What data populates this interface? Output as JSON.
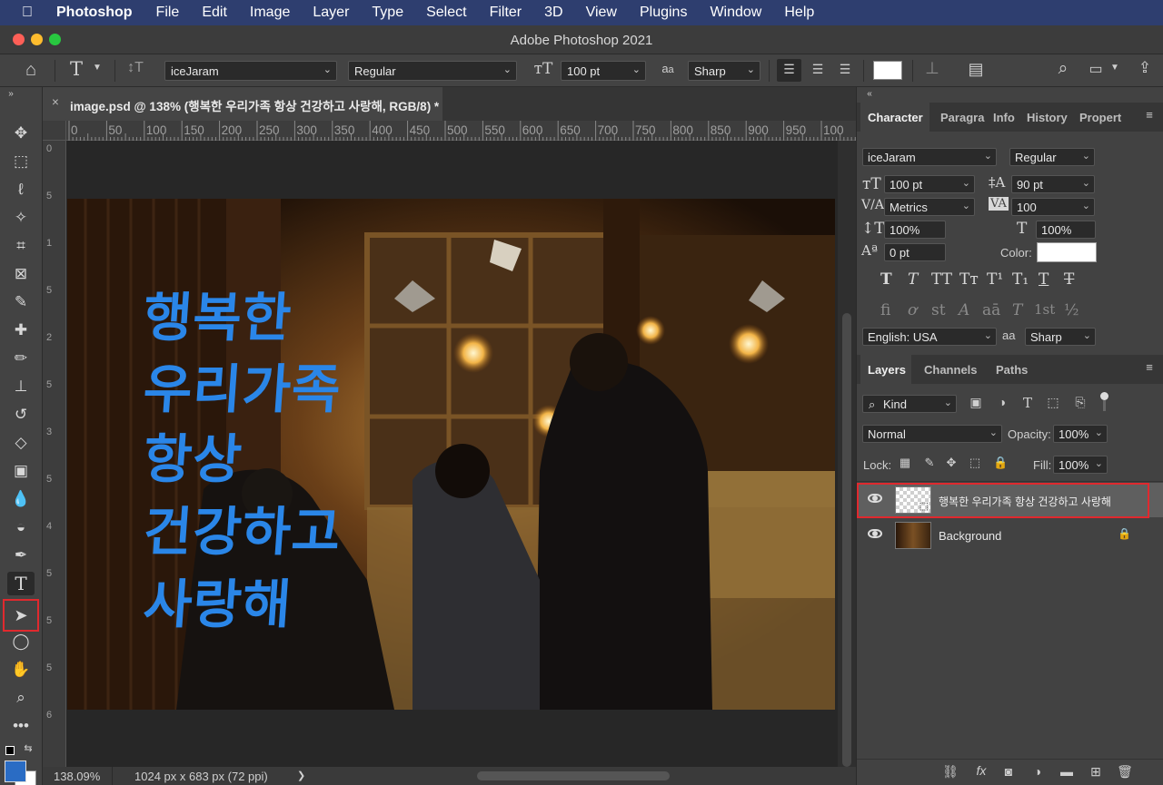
{
  "menubar": {
    "app_name": "Photoshop",
    "items": [
      "File",
      "Edit",
      "Image",
      "Layer",
      "Type",
      "Select",
      "Filter",
      "3D",
      "View",
      "Plugins",
      "Window",
      "Help"
    ]
  },
  "window": {
    "title": "Adobe Photoshop 2021"
  },
  "options": {
    "font_family": "iceJaram",
    "font_style": "Regular",
    "font_size": "100 pt",
    "aa_label": "a",
    "aa_sub": "a",
    "antialias": "Sharp",
    "text_color": "#ffffff"
  },
  "document": {
    "tab_title": "image.psd @ 138% (행복한 우리가족 항상 건강하고 사랑해, RGB/8) *",
    "close": "×",
    "text_lines": [
      "행복한",
      "우리가족",
      "항상",
      "건강하고",
      "사랑해"
    ],
    "text_color": "#2a86e8"
  },
  "ruler": {
    "h": [
      "0",
      "50",
      "100",
      "150",
      "200",
      "250",
      "300",
      "350",
      "400",
      "450",
      "500",
      "550",
      "600",
      "650",
      "700",
      "750",
      "800",
      "850",
      "900",
      "950",
      "100"
    ],
    "v": [
      "0",
      "5",
      "1",
      "5",
      "2",
      "5",
      "3",
      "5",
      "4",
      "5",
      "5",
      "5",
      "6"
    ]
  },
  "status": {
    "zoom": "138.09%",
    "info": "1024 px x 683 px (72 ppi)",
    "arrow": "❯"
  },
  "panel_tabs": [
    "Character",
    "Paragra",
    "Info",
    "History",
    "Propert"
  ],
  "character": {
    "font_family": "iceJaram",
    "font_style": "Regular",
    "size": "100 pt",
    "leading": "90 pt",
    "kerning": "Metrics",
    "tracking": "100",
    "vscale": "100%",
    "hscale": "100%",
    "baseline": "0 pt",
    "color_label": "Color:",
    "color": "#ffffff",
    "glyphs_row1": [
      "T",
      "T",
      "TT",
      "Tт",
      "T¹",
      "T₁",
      "T",
      "T"
    ],
    "glyphs_row2": [
      "fi",
      "ơ",
      "st",
      "A",
      "aā",
      "T",
      "1st",
      "½"
    ],
    "language": "English: USA",
    "antialias": "Sharp"
  },
  "layers_tabs": [
    "Layers",
    "Channels",
    "Paths"
  ],
  "layers": {
    "kind_label": "Kind",
    "blend_mode": "Normal",
    "opacity_label": "Opacity:",
    "opacity": "100%",
    "lock_label": "Lock:",
    "fill_label": "Fill:",
    "fill": "100%",
    "items": [
      {
        "name": "행복한 우리가족 항상 건강하고 사랑해",
        "selected": true
      },
      {
        "name": "Background",
        "selected": false
      }
    ]
  },
  "colors": {
    "accent": "#e0292e",
    "foreground": "#2a6cc4",
    "background": "#ffffff"
  }
}
